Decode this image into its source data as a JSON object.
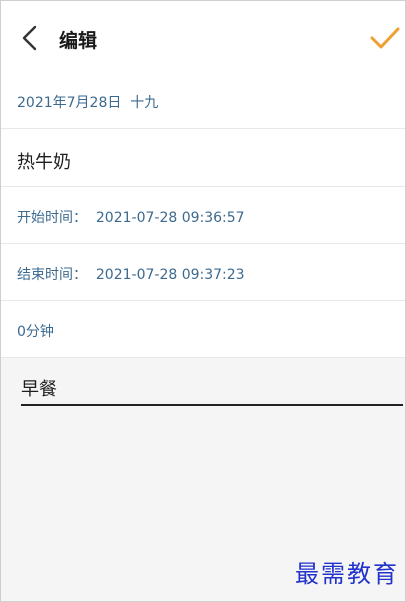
{
  "header": {
    "title": "编辑",
    "back_icon": "chevron-left-icon",
    "confirm_icon": "checkmark-icon",
    "accent_color": "#f0a030"
  },
  "record": {
    "date": "2021年7月28日  十九",
    "name": "热牛奶",
    "start_time": "开始时间：  2021-07-28 09:36:57",
    "end_time": "结束时间：  2021-07-28 09:37:23",
    "duration": "0分钟",
    "note": "早餐"
  },
  "watermark": {
    "text": "最需教育"
  }
}
